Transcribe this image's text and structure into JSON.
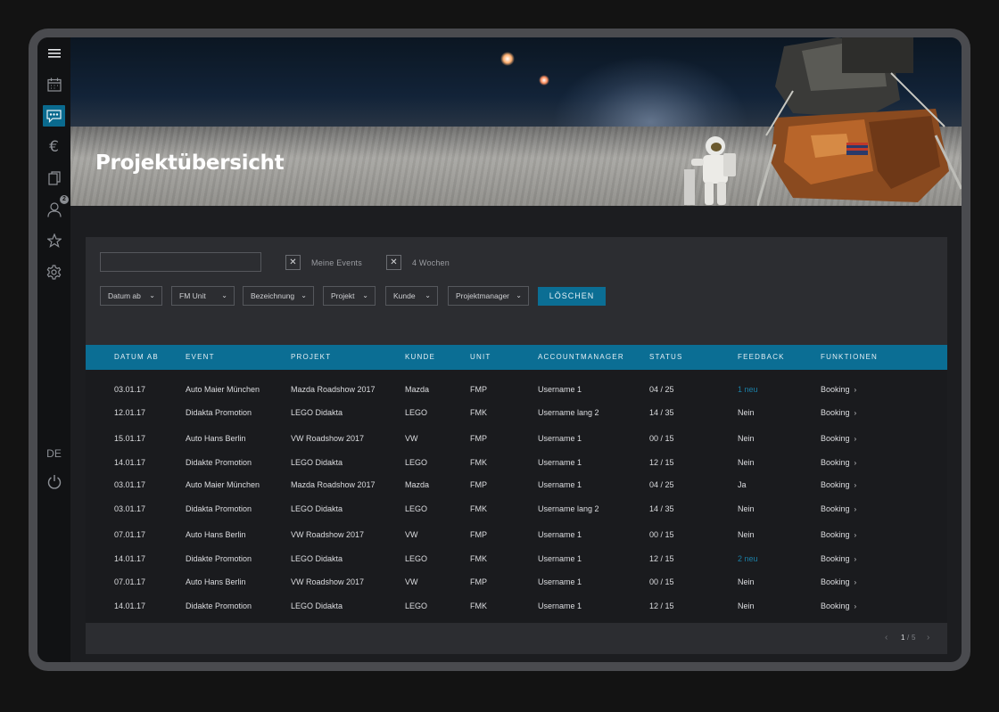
{
  "sidebar": {
    "items": [
      {
        "icon": "menu-icon"
      },
      {
        "icon": "calendar-icon"
      },
      {
        "icon": "chat-icon"
      },
      {
        "icon": "euro-icon",
        "glyph": "€"
      },
      {
        "icon": "documents-icon"
      },
      {
        "icon": "user-icon",
        "badge": "2"
      },
      {
        "icon": "star-icon"
      },
      {
        "icon": "settings-icon"
      }
    ],
    "language": "DE",
    "power": {
      "icon": "power-icon"
    }
  },
  "hero": {
    "title": "Projektübersicht"
  },
  "filters": {
    "search": {
      "value": "",
      "placeholder": ""
    },
    "checkbox_mark": "✕",
    "toggles": [
      {
        "label": "Meine Events",
        "checked": true
      },
      {
        "label": "4 Wochen",
        "checked": true
      }
    ],
    "dropdowns": [
      {
        "label": "Datum ab"
      },
      {
        "label": "FM Unit"
      },
      {
        "label": "Bezeichnung"
      },
      {
        "label": "Projekt"
      },
      {
        "label": "Kunde"
      },
      {
        "label": "Projektmanager"
      }
    ],
    "clear_label": "LÖSCHEN"
  },
  "table": {
    "columns": [
      "DATUM AB",
      "EVENT",
      "PROJEKT",
      "KUNDE",
      "UNIT",
      "ACCOUNTMANAGER",
      "STATUS",
      "FEEDBACK",
      "FUNKTIONEN"
    ],
    "rows": [
      {
        "datum": "03.01.17",
        "event": "Auto Maier München",
        "projekt": "Mazda Roadshow 2017",
        "kunde": "Mazda",
        "unit": "FMP",
        "manager": "Username 1",
        "status": "04 / 25",
        "feedback": "1 neu",
        "feedback_link": true,
        "funktion": "Booking"
      },
      {
        "datum": "12.01.17",
        "event": "Didakta Promotion",
        "projekt": "LEGO Didakta",
        "kunde": "LEGO",
        "unit": "FMK",
        "manager": "Username lang 2",
        "status": "14 / 35",
        "feedback": "Nein",
        "feedback_link": false,
        "funktion": "Booking"
      },
      {
        "datum": "15.01.17",
        "event": "Auto Hans Berlin",
        "projekt": "VW Roadshow 2017",
        "kunde": "VW",
        "unit": "FMP",
        "manager": "Username 1",
        "status": "00 / 15",
        "feedback": "Nein",
        "feedback_link": false,
        "funktion": "Booking"
      },
      {
        "datum": "14.01.17",
        "event": "Didakte Promotion",
        "projekt": "LEGO Didakta",
        "kunde": "LEGO",
        "unit": "FMK",
        "manager": "Username 1",
        "status": "12 / 15",
        "feedback": "Nein",
        "feedback_link": false,
        "funktion": "Booking"
      },
      {
        "datum": "03.01.17",
        "event": "Auto Maier München",
        "projekt": "Mazda Roadshow 2017",
        "kunde": "Mazda",
        "unit": "FMP",
        "manager": "Username 1",
        "status": "04 / 25",
        "feedback": "Ja",
        "feedback_link": false,
        "funktion": "Booking"
      },
      {
        "datum": "03.01.17",
        "event": "Didakta Promotion",
        "projekt": "LEGO Didakta",
        "kunde": "LEGO",
        "unit": "FMK",
        "manager": "Username lang 2",
        "status": "14 / 35",
        "feedback": "Nein",
        "feedback_link": false,
        "funktion": "Booking"
      },
      {
        "datum": "07.01.17",
        "event": "Auto Hans Berlin",
        "projekt": "VW Roadshow 2017",
        "kunde": "VW",
        "unit": "FMP",
        "manager": "Username 1",
        "status": "00 / 15",
        "feedback": "Nein",
        "feedback_link": false,
        "funktion": "Booking"
      },
      {
        "datum": "14.01.17",
        "event": "Didakte Promotion",
        "projekt": "LEGO Didakta",
        "kunde": "LEGO",
        "unit": "FMK",
        "manager": "Username 1",
        "status": "12 / 15",
        "feedback": "2 neu",
        "feedback_link": true,
        "funktion": "Booking"
      },
      {
        "datum": "07.01.17",
        "event": "Auto Hans Berlin",
        "projekt": "VW Roadshow 2017",
        "kunde": "VW",
        "unit": "FMP",
        "manager": "Username 1",
        "status": "00 / 15",
        "feedback": "Nein",
        "feedback_link": false,
        "funktion": "Booking"
      },
      {
        "datum": "14.01.17",
        "event": "Didakte Promotion",
        "projekt": "LEGO Didakta",
        "kunde": "LEGO",
        "unit": "FMK",
        "manager": "Username 1",
        "status": "12 / 15",
        "feedback": "Nein",
        "feedback_link": false,
        "funktion": "Booking"
      }
    ],
    "row_chevron": "›"
  },
  "pagination": {
    "prev": "‹",
    "current": "1",
    "separator": "/",
    "total": "5",
    "next": "›"
  },
  "colors": {
    "accent": "#0b6e94",
    "link": "#1b7fa6",
    "background": "#1c1d20",
    "panel": "#2c2d31"
  }
}
